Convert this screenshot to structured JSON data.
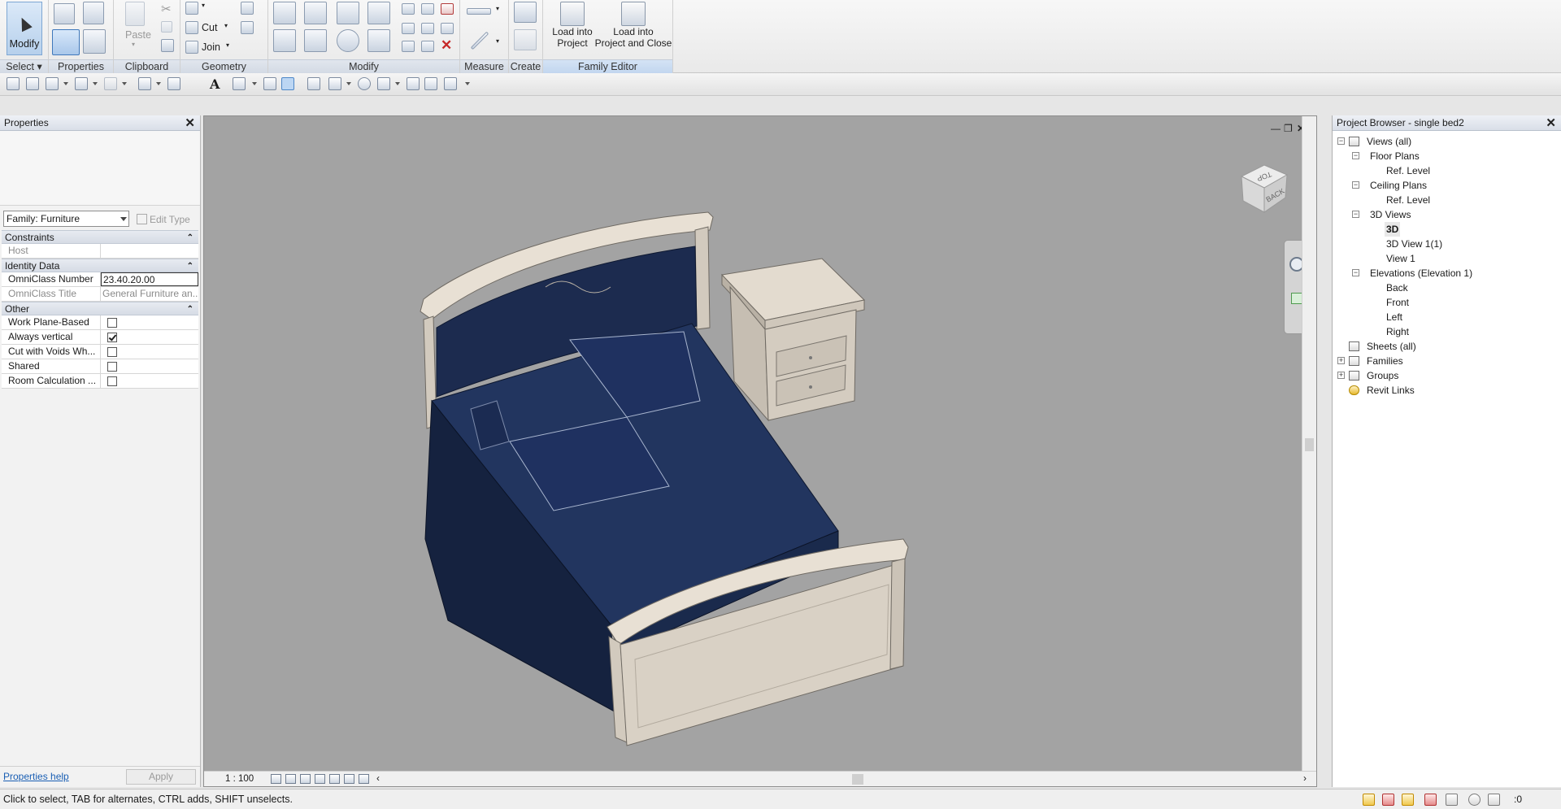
{
  "ribbon": {
    "modify_label": "Modify",
    "paste_label": "Paste",
    "cut_label": "Cut",
    "join_label": "Join",
    "load_into_project": [
      "Load into",
      "Project"
    ],
    "load_into_project_close": [
      "Load into",
      "Project and Close"
    ],
    "panels": {
      "select": "Select",
      "properties": "Properties",
      "clipboard": "Clipboard",
      "geometry": "Geometry",
      "modify": "Modify",
      "measure": "Measure",
      "create": "Create",
      "family_editor": "Family Editor"
    }
  },
  "properties": {
    "title": "Properties",
    "family_type": "Family: Furniture",
    "edit_type": "Edit Type",
    "groups": {
      "constraints": "Constraints",
      "identity_data": "Identity Data",
      "other": "Other"
    },
    "host_label": "Host",
    "omniclass_number_label": "OmniClass Number",
    "omniclass_number_value": "23.40.20.00",
    "omniclass_title_label": "OmniClass Title",
    "omniclass_title_value": "General Furniture an...",
    "work_plane_based_label": "Work Plane-Based",
    "work_plane_based": false,
    "always_vertical_label": "Always vertical",
    "always_vertical": true,
    "cut_with_voids_label": "Cut with Voids Wh...",
    "cut_with_voids": false,
    "shared_label": "Shared",
    "shared": false,
    "room_calculation_label": "Room Calculation ...",
    "room_calculation": false,
    "help_link": "Properties help",
    "apply_label": "Apply"
  },
  "viewport": {
    "scale": "1 : 100",
    "viewcube_top": "TOP",
    "viewcube_back": "BACK"
  },
  "browser": {
    "title": "Project Browser - single bed2",
    "nodes": [
      {
        "label": "Views (all)"
      },
      {
        "label": "Floor Plans"
      },
      {
        "label": "Ref. Level"
      },
      {
        "label": "Ceiling Plans"
      },
      {
        "label": "Ref. Level"
      },
      {
        "label": "3D Views"
      },
      {
        "label": "3D"
      },
      {
        "label": "3D View 1(1)"
      },
      {
        "label": "View 1"
      },
      {
        "label": "Elevations (Elevation 1)"
      },
      {
        "label": "Back"
      },
      {
        "label": "Front"
      },
      {
        "label": "Left"
      },
      {
        "label": "Right"
      },
      {
        "label": "Sheets (all)"
      },
      {
        "label": "Families"
      },
      {
        "label": "Groups"
      },
      {
        "label": "Revit Links"
      }
    ]
  },
  "status": {
    "hint": "Click to select, TAB for alternates, CTRL adds, SHIFT unselects.",
    "filter_count": ":0"
  },
  "colors": {
    "viewport_bg": "#a3a3a3",
    "bed_frame": "#d9d1c5",
    "bedding": "#1e2f55",
    "link": "#1a5fb4"
  }
}
